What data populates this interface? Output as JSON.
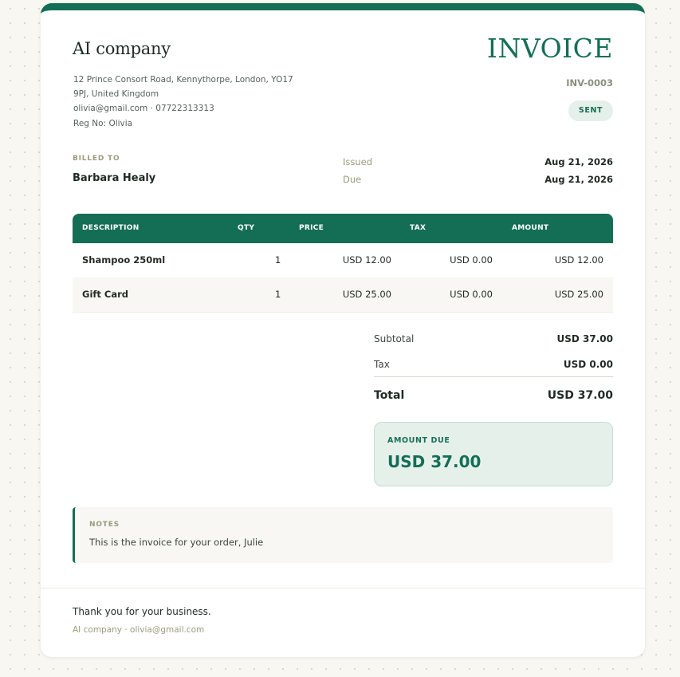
{
  "company": {
    "name": "AI company",
    "address_line1": "12 Prince Consort Road, Kennythorpe, London, YO17",
    "address_line2": "9PJ, United Kingdom",
    "contact": "olivia@gmail.com · 07722313313",
    "reg": "Reg No: Olivia"
  },
  "invoice": {
    "title": "INVOICE",
    "number": "INV-0003",
    "status": "SENT",
    "issued_label": "Issued",
    "issued_date": "Aug 21, 2026",
    "due_label": "Due",
    "due_date": "Aug 21, 2026"
  },
  "billed": {
    "label": "BILLED TO",
    "name": "Barbara Healy"
  },
  "table": {
    "headers": [
      "DESCRIPTION",
      "QTY",
      "PRICE",
      "TAX",
      "AMOUNT"
    ],
    "rows": [
      {
        "description": "Shampoo 250ml",
        "qty": "1",
        "price": "USD 12.00",
        "tax": "USD 0.00",
        "amount": "USD 12.00"
      },
      {
        "description": "Gift Card",
        "qty": "1",
        "price": "USD 25.00",
        "tax": "USD 0.00",
        "amount": "USD 25.00"
      }
    ]
  },
  "summary": {
    "subtotal_label": "Subtotal",
    "subtotal_value": "USD 37.00",
    "tax_label": "Tax",
    "tax_value": "USD 0.00",
    "total_label": "Total",
    "total_value": "USD 37.00",
    "amount_due_label": "AMOUNT DUE",
    "amount_due_value": "USD 37.00"
  },
  "notes": {
    "label": "NOTES",
    "text": "This is the invoice for your order, Julie"
  },
  "footer": {
    "thanks": "Thank you for your business.",
    "contact": "AI company · olivia@gmail.com"
  },
  "colors": {
    "accent": "#146e55",
    "accent_light": "#e6f0eb",
    "muted": "#9c9a7d"
  }
}
